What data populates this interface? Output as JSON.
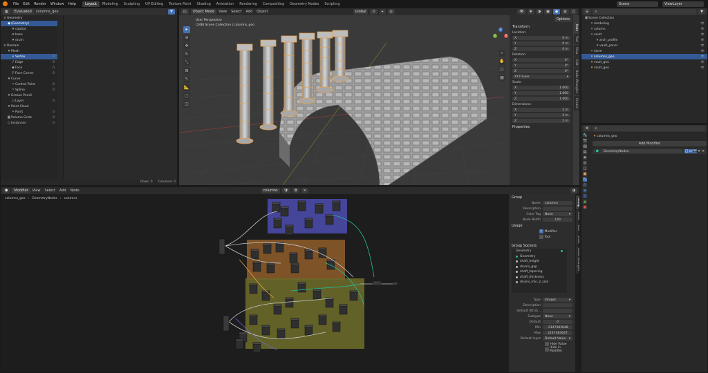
{
  "menu": [
    "File",
    "Edit",
    "Render",
    "Window",
    "Help"
  ],
  "workspaces": [
    "Layout",
    "Modeling",
    "Sculpting",
    "UV Editing",
    "Texture Paint",
    "Shading",
    "Animation",
    "Rendering",
    "Compositing",
    "Geometry Nodes",
    "Scripting"
  ],
  "active_workspace": "Layout",
  "scene": "Scene",
  "view_layer": "ViewLayer",
  "spreadsheet": {
    "eval_mode": "Evaluated",
    "object": "columns_geo",
    "rows_label": "Rows: 0",
    "cols_label": "Columns: 0",
    "tree": [
      {
        "label": "Geometry",
        "indent": 0,
        "count": "",
        "sel": false,
        "icon": "v"
      },
      {
        "label": "(Geometry)",
        "indent": 1,
        "count": "",
        "sel": true,
        "icon": "◆"
      },
      {
        "label": "capital",
        "indent": 2,
        "count": "",
        "sel": false,
        "icon": "▾"
      },
      {
        "label": "base",
        "indent": 2,
        "count": "",
        "sel": false,
        "icon": "▾"
      },
      {
        "label": "drum",
        "indent": 2,
        "count": "",
        "sel": false,
        "icon": "▾"
      },
      {
        "label": "Domain",
        "indent": 0,
        "count": "",
        "sel": false,
        "icon": "v"
      },
      {
        "label": "Mesh",
        "indent": 1,
        "count": "",
        "sel": false,
        "icon": "▾"
      },
      {
        "label": "Vertex",
        "indent": 2,
        "count": "0",
        "sel": true,
        "icon": "•"
      },
      {
        "label": "Edge",
        "indent": 2,
        "count": "0",
        "sel": false,
        "icon": "/"
      },
      {
        "label": "Face",
        "indent": 2,
        "count": "0",
        "sel": false,
        "icon": "▪"
      },
      {
        "label": "Face Corner",
        "indent": 2,
        "count": "0",
        "sel": false,
        "icon": "◸"
      },
      {
        "label": "Curve",
        "indent": 1,
        "count": "",
        "sel": false,
        "icon": "▾"
      },
      {
        "label": "Control Point",
        "indent": 2,
        "count": "0",
        "sel": false,
        "icon": "•"
      },
      {
        "label": "Spline",
        "indent": 2,
        "count": "0",
        "sel": false,
        "icon": "~"
      },
      {
        "label": "Grease Pencil",
        "indent": 1,
        "count": "",
        "sel": false,
        "icon": "▾"
      },
      {
        "label": "Layer",
        "indent": 2,
        "count": "0",
        "sel": false,
        "icon": "▭"
      },
      {
        "label": "Point Cloud",
        "indent": 1,
        "count": "",
        "sel": false,
        "icon": "▾"
      },
      {
        "label": "Point",
        "indent": 2,
        "count": "0",
        "sel": false,
        "icon": "•"
      },
      {
        "label": "Volume Grids",
        "indent": 1,
        "count": "0",
        "sel": false,
        "icon": "▦"
      },
      {
        "label": "Instances",
        "indent": 1,
        "count": "0",
        "sel": false,
        "icon": "◇"
      }
    ]
  },
  "viewport": {
    "mode": "Object Mode",
    "menus": [
      "View",
      "Select",
      "Add",
      "Object"
    ],
    "transform": "Global",
    "options": "Options",
    "persp": "User Perspective",
    "collection": "(248) Scene Collection | columns_geo",
    "npanel": {
      "title": "Transform",
      "location_label": "Location:",
      "loc": [
        "0 m",
        "0 m",
        "0 m"
      ],
      "rotation_label": "Rotation:",
      "rot": [
        "0°",
        "0°",
        "0°"
      ],
      "rot_mode": "XYZ Euler",
      "scale_label": "Scale:",
      "scale": [
        "1.000",
        "1.000",
        "1.000"
      ],
      "dims_label": "Dimensions:",
      "dims": [
        "2 m",
        "2 m",
        "2 m"
      ],
      "properties": "Properties"
    },
    "tabs": [
      "Item",
      "Tool",
      "View",
      "Edit",
      "Node Wrangler",
      "Create"
    ],
    "axes": [
      "X",
      "Y",
      "Z"
    ]
  },
  "outliner": {
    "title": "Scene Collection",
    "items": [
      {
        "label": "rendering",
        "indent": 1,
        "sel": false,
        "color": "#8a8a8a"
      },
      {
        "label": "column",
        "indent": 1,
        "sel": false,
        "color": "#8a8a8a"
      },
      {
        "label": "vault",
        "indent": 1,
        "sel": false,
        "color": "#8a8a8a"
      },
      {
        "label": "arch_profile",
        "indent": 2,
        "sel": false,
        "color": "#e8a04a"
      },
      {
        "label": "vault_panel",
        "indent": 2,
        "sel": false,
        "color": "#e8a04a"
      },
      {
        "label": "store",
        "indent": 1,
        "sel": false,
        "color": "#8a8a8a"
      },
      {
        "label": "columns_geo",
        "indent": 1,
        "sel": true,
        "color": "#e8a04a"
      },
      {
        "label": "vault_geo",
        "indent": 1,
        "sel": false,
        "color": "#e8a04a"
      },
      {
        "label": "vault_geo",
        "indent": 1,
        "sel": false,
        "color": "#e8a04a"
      }
    ]
  },
  "properties": {
    "object": "columns_geo",
    "add_modifier": "Add Modifier",
    "modifier": "GeometryNodes"
  },
  "node_editor": {
    "type": "Modifier",
    "menus": [
      "View",
      "Select",
      "Add",
      "Node"
    ],
    "tree_name": "columns",
    "breadcrumb": [
      "columns_geo",
      "GeometryNodes",
      "columns"
    ],
    "group_panel": {
      "title": "Group",
      "name_label": "Name",
      "name": "columns",
      "desc_label": "Description",
      "color_tag_label": "Color Tag",
      "color_tag": "None",
      "width_label": "Node Width",
      "width": "140",
      "usage_label": "Usage",
      "modifier": "Modifier",
      "tool": "Tool",
      "sockets_title": "Group Sockets",
      "sockets": [
        "Geometry",
        "Geometry",
        "shaft_height",
        "drums_gap",
        "shaft_tapering",
        "shaft_thickness",
        "drums_min_2_size"
      ],
      "type_label": "Type",
      "type": "Integer",
      "desc2_label": "Description",
      "default_attr_label": "Default Attrib...",
      "subtype_label": "Subtype",
      "subtype": "None",
      "default_label": "Default",
      "default": "0",
      "min_label": "Min",
      "min": "-2147483648",
      "max_label": "Max",
      "max": "2147483647",
      "default_input_label": "Default Input",
      "default_input": "Default Value",
      "hide_value": "Hide Value",
      "hide_modifier": "Hide in Modifier"
    },
    "tabs": [
      "Group",
      "Node",
      "Tool",
      "View",
      "Node Wrangler"
    ]
  }
}
